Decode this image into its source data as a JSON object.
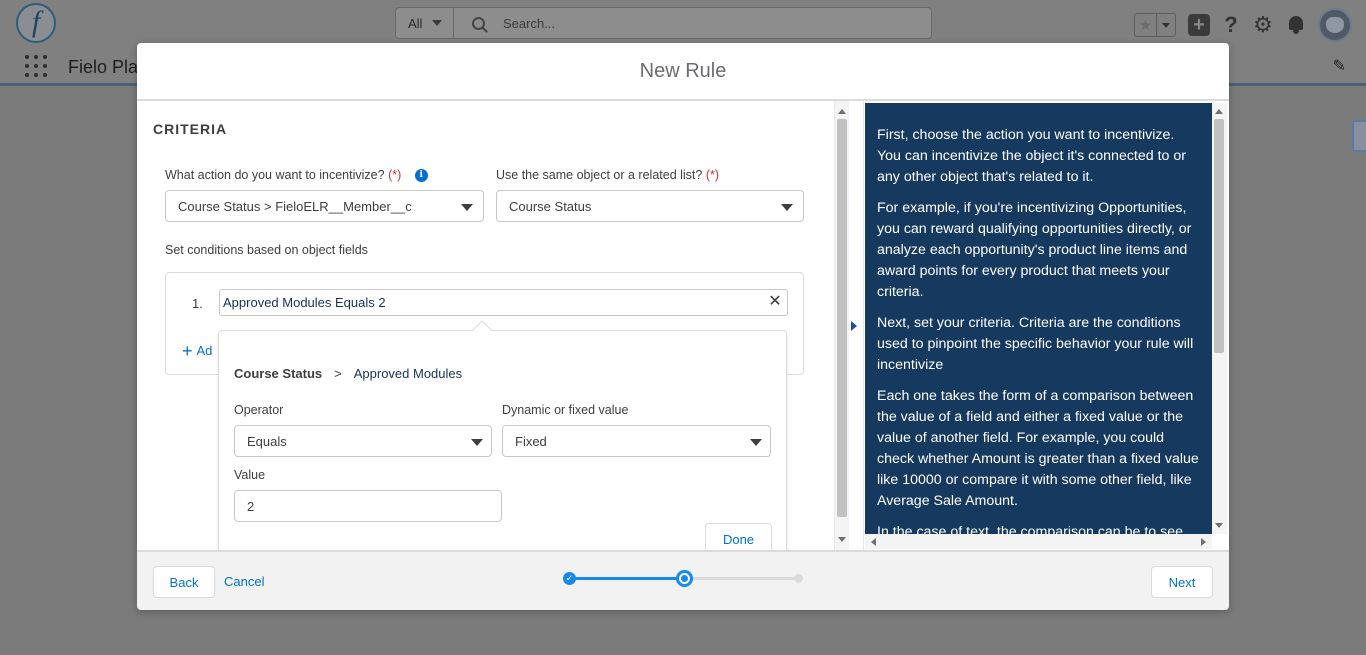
{
  "shell": {
    "app_name": "Fielo Pla",
    "search": {
      "scope": "All",
      "placeholder": "Search..."
    }
  },
  "modal": {
    "title": "New Rule",
    "criteria_heading": "CRITERIA",
    "action_label": "What action do you want to incentivize?",
    "required_marker": "(*)",
    "action_value": "Course Status > FieloELR__Member__c",
    "object_label": "Use the same object or a related list?",
    "object_value": "Course Status",
    "conditions_label": "Set conditions based on object fields",
    "condition": {
      "number": "1.",
      "text": "Approved Modules Equals 2"
    },
    "add_link": "Ad",
    "popover": {
      "breadcrumb_object": "Course Status",
      "breadcrumb_sep": ">",
      "breadcrumb_field": "Approved Modules",
      "operator_label": "Operator",
      "operator_value": "Equals",
      "dynamic_label": "Dynamic or fixed value",
      "dynamic_value": "Fixed",
      "value_label": "Value",
      "value": "2",
      "done_label": "Done"
    },
    "help": [
      "First, choose the action you want to incentivize. You can incentivize the object it's connected to or any other object that's related to it.",
      "For example, if you're incentivizing Opportunities, you can reward qualifying opportunities directly, or analyze each opportunity's product line items and award points for every product that meets your criteria.",
      "Next, set your criteria. Criteria are the conditions used to pinpoint the specific behavior your rule will incentivize",
      "Each one takes the form of a comparison between the value of a field and either a fixed value or the value of another field. For example, you could check whether Amount is greater than a fixed value like 10000 or compare it with some other field, like Average Sale Amount.",
      "In the case of text, the comparison can be to see"
    ],
    "footer": {
      "back": "Back",
      "cancel": "Cancel",
      "next": "Next",
      "steps_total": 3,
      "current_step": 2
    }
  },
  "colors": {
    "accent": "#0070d2",
    "progress": "#1589ee",
    "help_bg": "#163a5f",
    "required": "#c23934"
  }
}
